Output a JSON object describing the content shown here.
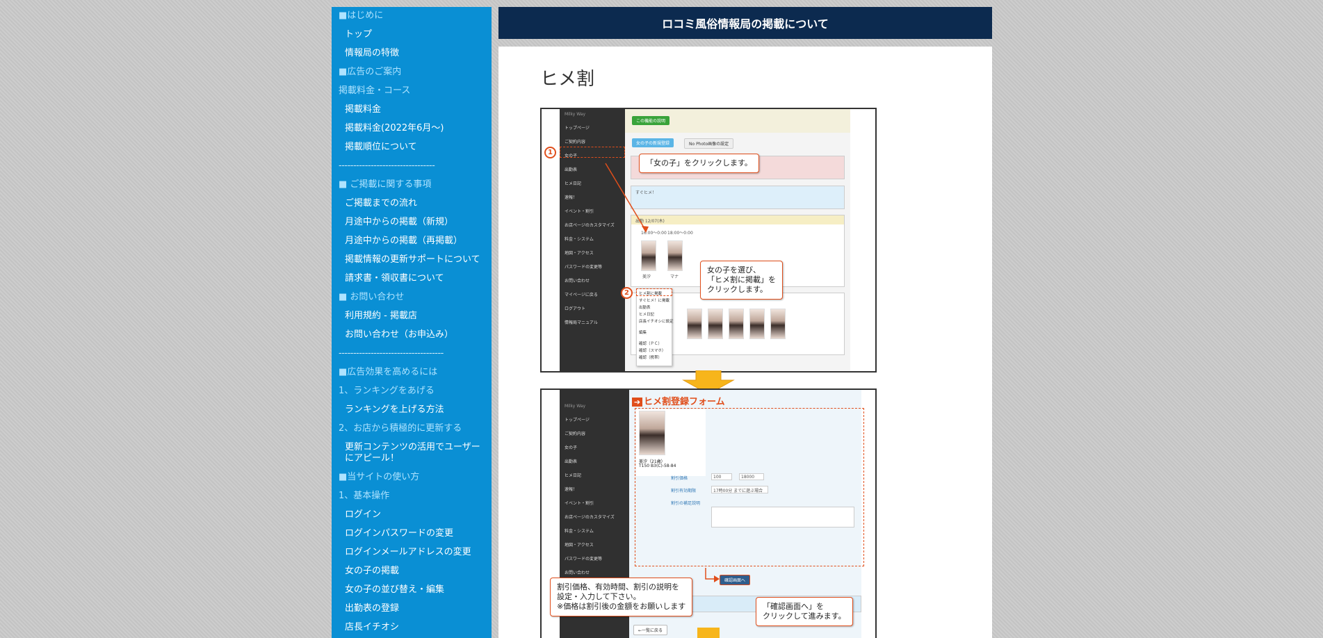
{
  "header": {
    "title": "ロコミ風俗情報局の掲載について"
  },
  "main": {
    "page_title": "ヒメ割"
  },
  "sidebar": {
    "items": [
      {
        "label": "■はじめに",
        "type": "h"
      },
      {
        "label": "トップ",
        "type": "link"
      },
      {
        "label": "情報局の特徴",
        "type": "link"
      },
      {
        "label": "■広告のご案内",
        "type": "h"
      },
      {
        "label": "掲載料金・コース",
        "type": "h"
      },
      {
        "label": "掲載料金",
        "type": "link"
      },
      {
        "label": "掲載料金(2022年6月～)",
        "type": "link"
      },
      {
        "label": "掲載順位について",
        "type": "link"
      },
      {
        "label": "---------------------------------",
        "type": "sep"
      },
      {
        "label": "■ ご掲載に関する事項",
        "type": "h"
      },
      {
        "label": "ご掲載までの流れ",
        "type": "link"
      },
      {
        "label": "月途中からの掲載（新規）",
        "type": "link"
      },
      {
        "label": "月途中からの掲載（再掲載）",
        "type": "link"
      },
      {
        "label": "掲載情報の更新サポートについて",
        "type": "link"
      },
      {
        "label": "請求書・領収書について",
        "type": "link"
      },
      {
        "label": "■ お問い合わせ",
        "type": "h"
      },
      {
        "label": "利用規約 - 掲載店",
        "type": "link"
      },
      {
        "label": "お問い合わせ（お申込み）",
        "type": "link"
      },
      {
        "label": "------------------------------------",
        "type": "sep"
      },
      {
        "label": "■広告効果を高めるには",
        "type": "h"
      },
      {
        "label": "1、ランキングをあげる",
        "type": "h"
      },
      {
        "label": "ランキングを上げる方法",
        "type": "link"
      },
      {
        "label": "2、お店から積極的に更新する",
        "type": "h"
      },
      {
        "label": "更新コンテンツの活用でユーザーにアピール！",
        "type": "link"
      },
      {
        "label": "■当サイトの使い方",
        "type": "h"
      },
      {
        "label": "1、基本操作",
        "type": "h"
      },
      {
        "label": "ログイン",
        "type": "link"
      },
      {
        "label": "ログインパスワードの変更",
        "type": "link"
      },
      {
        "label": "ログインメールアドレスの変更",
        "type": "link"
      },
      {
        "label": "女の子の掲載",
        "type": "link"
      },
      {
        "label": "女の子の並び替え・編集",
        "type": "link"
      },
      {
        "label": "出勤表の登録",
        "type": "link"
      },
      {
        "label": "店長イチオシ",
        "type": "link"
      }
    ]
  },
  "shot1": {
    "side_items": [
      "Milky Way",
      "トップページ",
      "ご契約内容",
      "女の子",
      "出勤表",
      "ヒメ日記",
      "速報！",
      "イベント・割引",
      "お店ページのカスタマイズ",
      "料金・システム",
      "地図・アクセス",
      "パスワードの変更等",
      "お問い合わせ",
      "マイページに戻る",
      "ログアウト",
      "情報局マニュアル"
    ],
    "btn_explain": "この機能の説明",
    "tab_register": "女の子の新規登録",
    "tab_nophoto": "No Photo画像の設定",
    "sugu": "すぐヒメ！",
    "date_label": "出勤 12/07(木)",
    "slot1": "16:00～0:00",
    "slot2": "18:00～0:00",
    "girl1": "美汐",
    "girl2": "マナ",
    "menu": [
      "ヒメ割に掲載",
      "すぐヒメ！に掲載",
      "出勤表",
      "ヒメ日記",
      "店長イチオシに設定",
      "編集",
      "確認（ＰＣ）",
      "確認（スマホ）",
      "確認（携帯）"
    ],
    "callout1": "「女の子」をクリックします。",
    "callout2": "女の子を選び、\n「ヒメ割に掲載」を\nクリックします。",
    "num1": "1",
    "num2": "2"
  },
  "shot2": {
    "form_title": "ヒメ割登録フォーム",
    "side_items": [
      "Milky Way",
      "トップページ",
      "ご契約内容",
      "女の子",
      "出勤表",
      "ヒメ日記",
      "速報！",
      "イベント・割引",
      "お店ページのカスタマイズ",
      "料金・システム",
      "地図・アクセス",
      "パスワードの変更等",
      "お問い合わせ"
    ],
    "girl_name": "美汐（21歳）",
    "girl_size": "T150 B3(C)-58-84",
    "field_price": "割引価格",
    "field_time": "割引有効期限",
    "field_desc": "割引の補足説明",
    "price_from": "100",
    "price_to": "18000",
    "time_value": "17時00分 までに遊ぶ場合",
    "confirm_btn": "確認画面へ",
    "back_btn": "←一覧に戻る",
    "callout_main": "割引価格、有効時間、割引の説明を\n設定・入力して下さい。\n※価格は割引後の金額をお願いします",
    "callout_confirm": "「確認画面へ」を\nクリックして進みます。"
  }
}
